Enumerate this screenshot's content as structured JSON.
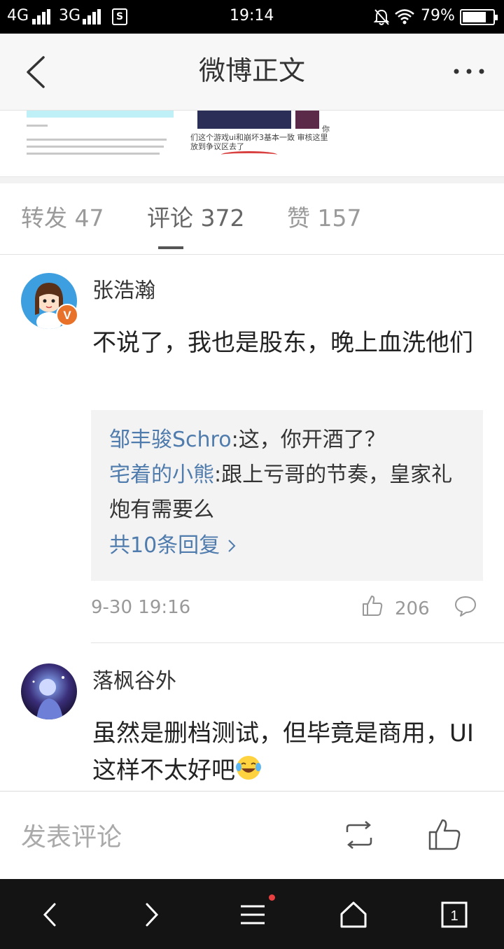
{
  "status_bar": {
    "network_1": "4G",
    "network_2": "3G",
    "sim_icon": "S",
    "time": "19:14",
    "battery": "79%",
    "battery_level": 0.79,
    "icons": [
      "signal-icon",
      "sim-icon",
      "mute-bell-icon",
      "wifi-icon",
      "battery-icon"
    ]
  },
  "header": {
    "title": "微博正文",
    "back_icon": "chevron-left-icon",
    "more_icon": "more-dots-icon"
  },
  "post_images": {
    "image2_caption": "们这个游戏ui和崩坏3基本一致 审核这里放到争议区去了",
    "image2_side_text": "你"
  },
  "tabs": [
    {
      "label": "转发 47",
      "active": false
    },
    {
      "label": "评论 372",
      "active": true
    },
    {
      "label": "赞 157",
      "active": false
    }
  ],
  "comments": [
    {
      "username": "张浩瀚",
      "verified_badge": "V",
      "text": "不说了，我也是股东，晚上血洗他们",
      "replies": [
        {
          "user": "邹丰骏Schro",
          "text": ":这，你开酒了？"
        },
        {
          "user": "宅着的小熊",
          "text": ":跟上亏哥的节奏，皇家礼炮有需要么"
        }
      ],
      "more_replies": "共10条回复",
      "time": "9-30 19:16",
      "likes": "206"
    },
    {
      "username": "落枫谷外",
      "text": "虽然是删档测试，但毕竟是商用，UI这样不太好吧",
      "emoji": "laugh-cry-emoji"
    }
  ],
  "comment_bar": {
    "placeholder": "发表评论",
    "repost_icon": "repost-icon",
    "like_icon": "thumbs-up-icon"
  },
  "system_nav": {
    "tab_count": "1",
    "icons": [
      "back-arrow-icon",
      "forward-arrow-icon",
      "menu-icon",
      "home-icon",
      "tabs-icon"
    ]
  },
  "colors": {
    "link_blue": "#4f7cad",
    "verified_badge": "#e8722a",
    "notification_dot": "#e84040"
  }
}
